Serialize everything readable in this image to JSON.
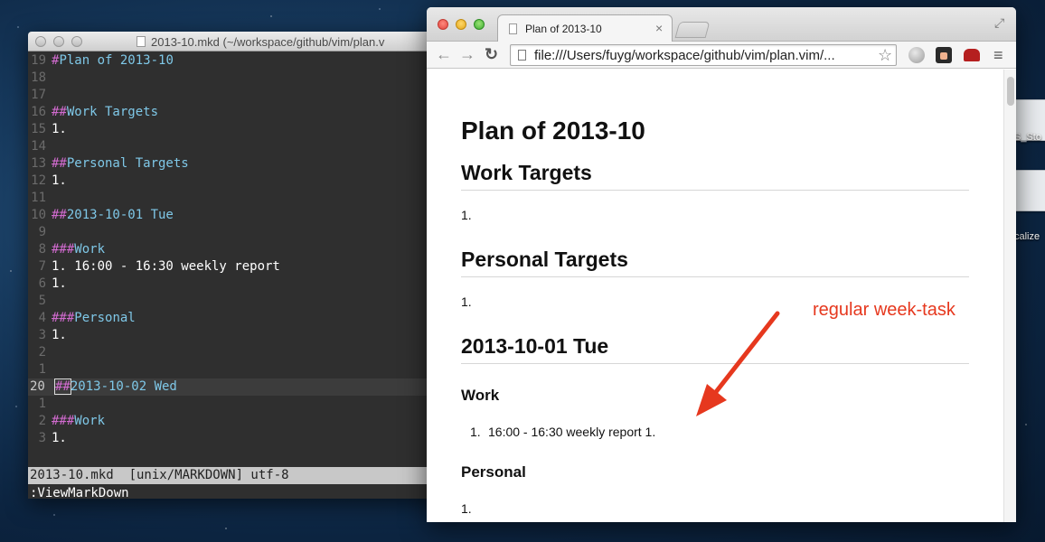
{
  "desktop": {
    "icons": [
      {
        "label": "S_Sto"
      },
      {
        "label": "calize"
      }
    ]
  },
  "vim": {
    "title": "2013-10.mkd (~/workspace/github/vim/plan.v",
    "lines": [
      {
        "num": "19",
        "mk": "#",
        "hd": "Plan of 2013-10",
        "tx": ""
      },
      {
        "num": "18",
        "mk": "",
        "hd": "",
        "tx": ""
      },
      {
        "num": "17",
        "mk": "",
        "hd": "",
        "tx": ""
      },
      {
        "num": "16",
        "mk": "##",
        "hd": "Work Targets",
        "tx": ""
      },
      {
        "num": "15",
        "mk": "",
        "hd": "",
        "tx": "1."
      },
      {
        "num": "14",
        "mk": "",
        "hd": "",
        "tx": ""
      },
      {
        "num": "13",
        "mk": "##",
        "hd": "Personal Targets",
        "tx": ""
      },
      {
        "num": "12",
        "mk": "",
        "hd": "",
        "tx": "1."
      },
      {
        "num": "11",
        "mk": "",
        "hd": "",
        "tx": ""
      },
      {
        "num": "10",
        "mk": "##",
        "hd": "2013-10-01 Tue",
        "tx": ""
      },
      {
        "num": "9",
        "mk": "",
        "hd": "",
        "tx": ""
      },
      {
        "num": "8",
        "mk": "###",
        "hd": "Work",
        "tx": ""
      },
      {
        "num": "7",
        "mk": "",
        "hd": "",
        "tx": "1. 16:00 - 16:30 weekly report"
      },
      {
        "num": "6",
        "mk": "",
        "hd": "",
        "tx": "1."
      },
      {
        "num": "5",
        "mk": "",
        "hd": "",
        "tx": ""
      },
      {
        "num": "4",
        "mk": "###",
        "hd": "Personal",
        "tx": ""
      },
      {
        "num": "3",
        "mk": "",
        "hd": "",
        "tx": "1."
      },
      {
        "num": "2",
        "mk": "",
        "hd": "",
        "tx": ""
      },
      {
        "num": "1",
        "mk": "",
        "hd": "",
        "tx": ""
      },
      {
        "num": "20",
        "mk": "##",
        "hd": "2013-10-02 Wed",
        "tx": ""
      },
      {
        "num": "1",
        "mk": "",
        "hd": "",
        "tx": ""
      },
      {
        "num": "2",
        "mk": "###",
        "hd": "Work",
        "tx": ""
      },
      {
        "num": "3",
        "mk": "",
        "hd": "",
        "tx": "1."
      }
    ],
    "current_line_index": 19,
    "status": "2013-10.mkd  [unix/MARKDOWN] utf-8",
    "command": ":ViewMarkDown"
  },
  "browser": {
    "tab_title": "Plan of 2013-10",
    "tab_close": "×",
    "url": "file:///Users/fuyg/workspace/github/vim/plan.vim/...",
    "nav": {
      "back": "←",
      "forward": "→",
      "reload": "↻",
      "star": "☆",
      "menu": "≡",
      "expand": "⤢"
    },
    "page": {
      "h1": "Plan of 2013-10",
      "work_targets_heading": "Work Targets",
      "work_targets_item": "1.",
      "personal_targets_heading": "Personal Targets",
      "personal_targets_item": "1.",
      "day_heading": "2013-10-01 Tue",
      "work_heading": "Work",
      "work_item_number": "1.",
      "work_item_text": "16:00 - 16:30 weekly report 1.",
      "personal_heading": "Personal",
      "personal_item": "1."
    },
    "annotation": "regular week-task"
  },
  "colors": {
    "annotation": "#e6381e",
    "vim_background": "#2f2f2f",
    "markdown_marker": "#d26bd0",
    "markdown_heading": "#7fc8e8"
  }
}
